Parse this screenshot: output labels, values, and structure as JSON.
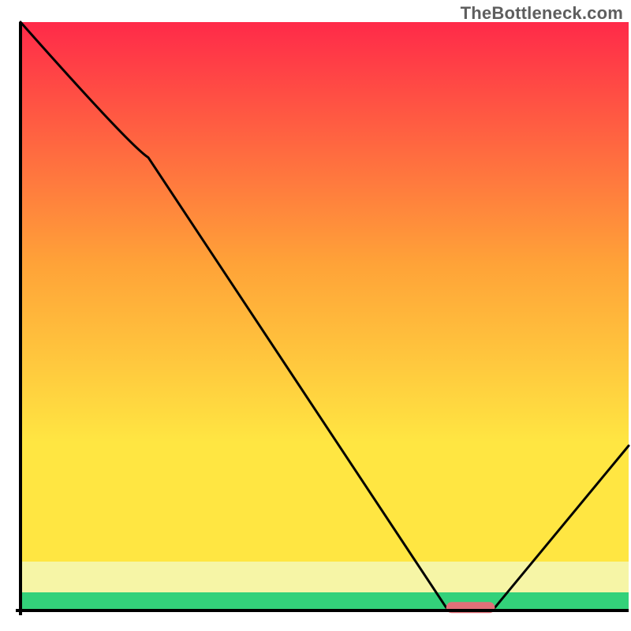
{
  "watermark": "TheBottleneck.com",
  "colors": {
    "gradient_top": "#ff2a49",
    "gradient_mid": "#ffa338",
    "gradient_low": "#ffe642",
    "gradient_pale": "#f6f5a6",
    "gradient_green": "#33d17a",
    "axis_stroke": "#000000",
    "curve_stroke": "#000000",
    "marker_fill": "#e17079",
    "watermark_color": "#5e5e5e"
  },
  "chart_data": {
    "type": "line",
    "title": "",
    "xlabel": "",
    "ylabel": "",
    "xlim": [
      0,
      100
    ],
    "ylim": [
      0,
      100
    ],
    "x": [
      0,
      21,
      70,
      78,
      100
    ],
    "values": [
      100,
      77,
      0.5,
      0.5,
      28
    ],
    "optimal_marker": {
      "x_start": 70,
      "x_end": 78,
      "y": 0.5
    },
    "bands": [
      {
        "name": "red-orange-yellow-gradient",
        "y_start": 8,
        "y_end": 100
      },
      {
        "name": "pale-yellow",
        "y_start": 3,
        "y_end": 8
      },
      {
        "name": "green",
        "y_start": 0,
        "y_end": 3
      }
    ]
  }
}
